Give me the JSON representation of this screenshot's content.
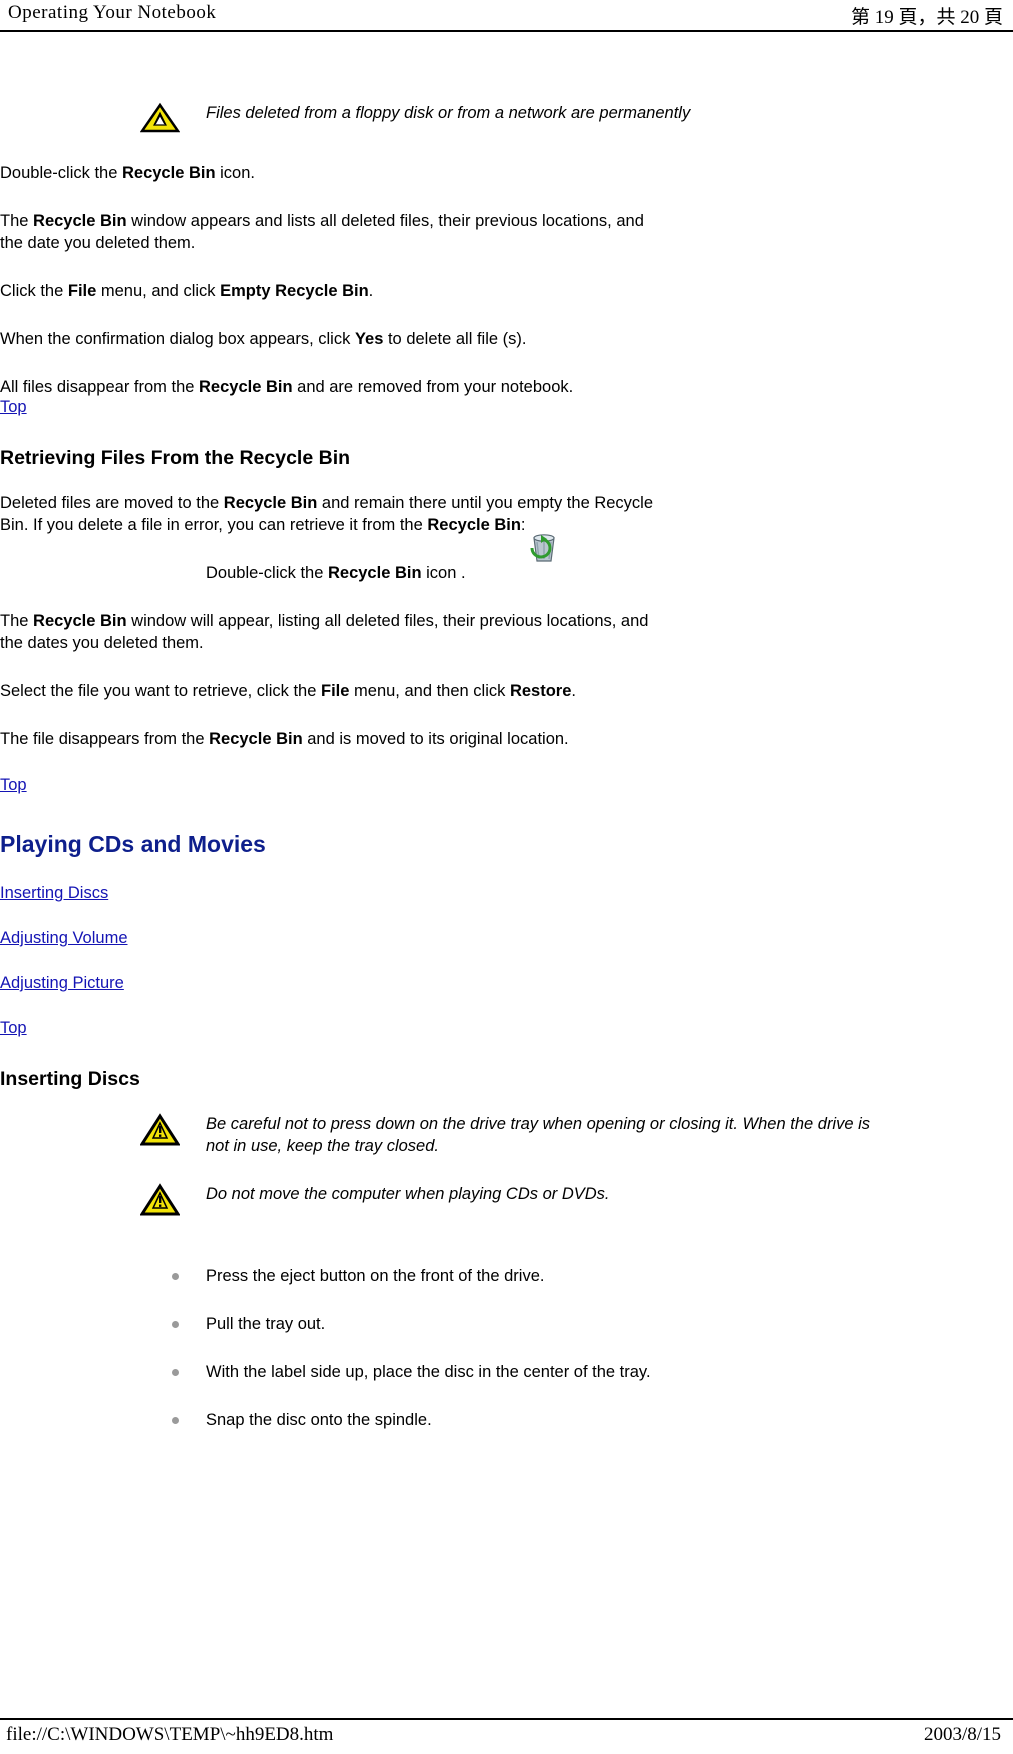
{
  "header": {
    "title": "Operating Your Notebook",
    "page_info": "第 19 頁，共 20 頁"
  },
  "footer": {
    "file_path": "file://C:\\WINDOWS\\TEMP\\~hh9ED8.htm",
    "date": "2003/8/15"
  },
  "content": {
    "note_top": "Files deleted from a floppy disk or from a network are permanently",
    "steps_empty": [
      {
        "parts": [
          {
            "t": "Double-click the ",
            "b": false
          },
          {
            "t": "Recycle Bin",
            "b": true
          },
          {
            "t": " icon.",
            "b": false
          }
        ]
      },
      {
        "parts": [
          {
            "t": "The ",
            "b": false
          },
          {
            "t": "Recycle Bin",
            "b": true
          },
          {
            "t": " window appears and lists all deleted files, their previous locations, and the date you deleted them.",
            "b": false
          }
        ]
      },
      {
        "parts": [
          {
            "t": "Click the ",
            "b": false
          },
          {
            "t": "File",
            "b": true
          },
          {
            "t": " menu, and click ",
            "b": false
          },
          {
            "t": "Empty Recycle Bin",
            "b": true
          },
          {
            "t": ".",
            "b": false
          }
        ]
      },
      {
        "parts": [
          {
            "t": "When the confirmation dialog box appears, click ",
            "b": false
          },
          {
            "t": "Yes",
            "b": true
          },
          {
            "t": " to delete all file (s).",
            "b": false
          }
        ]
      },
      {
        "parts": [
          {
            "t": "All files disappear from the ",
            "b": false
          },
          {
            "t": "Recycle Bin",
            "b": true
          },
          {
            "t": " and are removed from your notebook.",
            "b": false
          }
        ]
      }
    ],
    "top_link_1": "Top",
    "heading_retrieving": "Retrieving Files From the Recycle Bin",
    "retrieve_intro": {
      "parts": [
        {
          "t": "Deleted files are moved to the ",
          "b": false
        },
        {
          "t": "Recycle Bin",
          "b": true
        },
        {
          "t": " and remain there until you empty the Recycle Bin. If you delete a file in error, you can retrieve it from the ",
          "b": false
        },
        {
          "t": "Recycle Bin",
          "b": true
        },
        {
          "t": ":",
          "b": false
        }
      ]
    },
    "retrieve_steps": [
      {
        "parts": [
          {
            "t": "Double-click the ",
            "b": false
          },
          {
            "t": "Recycle Bin",
            "b": true
          },
          {
            "t": " icon .",
            "b": false
          }
        ]
      },
      {
        "parts": [
          {
            "t": "The ",
            "b": false
          },
          {
            "t": "Recycle Bin",
            "b": true
          },
          {
            "t": " window will appear, listing all deleted files, their previous locations, and the dates you deleted them.",
            "b": false
          }
        ]
      },
      {
        "parts": [
          {
            "t": "Select the file you want to retrieve, click the ",
            "b": false
          },
          {
            "t": "File",
            "b": true
          },
          {
            "t": " menu, and then click ",
            "b": false
          },
          {
            "t": "Restore",
            "b": true
          },
          {
            "t": ".",
            "b": false
          }
        ]
      },
      {
        "parts": [
          {
            "t": "The file disappears from the ",
            "b": false
          },
          {
            "t": "Recycle Bin",
            "b": true
          },
          {
            "t": " and is moved to its original location.",
            "b": false
          }
        ]
      }
    ],
    "top_link_2": "Top",
    "heading_playing": "Playing CDs and Movies",
    "toc_links": [
      "Inserting Discs",
      "Adjusting Volume",
      "Adjusting Picture"
    ],
    "top_link_3": "Top",
    "heading_inserting": "Inserting Discs",
    "note_tray": "Be careful not to press down on the drive tray when opening or closing it. When the drive is not in use, keep the tray closed.",
    "note_move": "Do not move the computer when playing CDs or DVDs.",
    "bullets": [
      "Press the eject button on the front of the drive.",
      "Pull the tray out.",
      "With the label side up, place the disc in the center of the tray.",
      "Snap the disc onto the spindle."
    ]
  },
  "colors": {
    "link": "#1414b4",
    "major_heading": "#0e1f8c",
    "warning_yellow": "#f2e307",
    "bullet_gray": "#9a9a9a"
  },
  "icons": {
    "warning": "warning-triangle-icon",
    "recycle_bin": "recycle-bin-icon"
  }
}
